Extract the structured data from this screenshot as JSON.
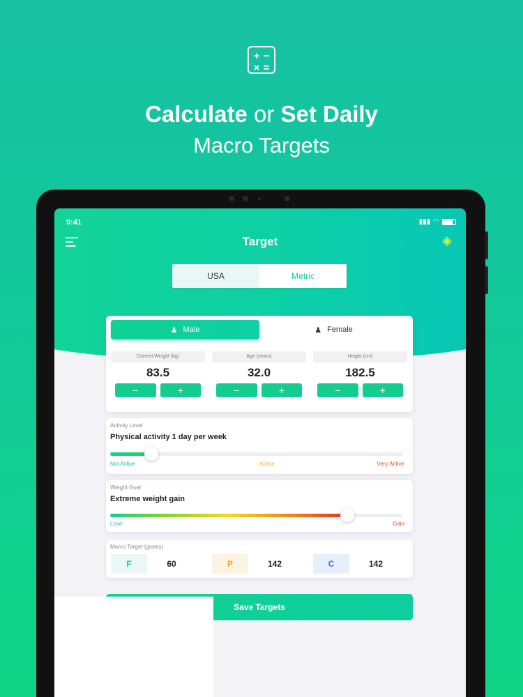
{
  "hero": {
    "title_bold_1": "Calculate",
    "title_middle": " or ",
    "title_bold_2": "Set Daily",
    "subtitle": "Macro Targets",
    "icon": "calculator-icon"
  },
  "status_bar": {
    "time": "9:41"
  },
  "nav": {
    "title": "Target",
    "menu_icon": "menu-icon",
    "premium_icon": "diamond-icon"
  },
  "units": {
    "options": [
      "USA",
      "Metric"
    ],
    "selected": "USA"
  },
  "gender": {
    "options": [
      "Male",
      "Female"
    ],
    "selected": "Male"
  },
  "metrics": [
    {
      "label": "Current Weight (kg)",
      "value": "83.5"
    },
    {
      "label": "Age (years)",
      "value": "32.0"
    },
    {
      "label": "Height (cm)",
      "value": "182.5"
    }
  ],
  "stepper": {
    "minus": "−",
    "plus": "+"
  },
  "activity": {
    "label": "Activity Level",
    "value": "Physical activity 1 day per week",
    "level": 0.14,
    "ticks": [
      "Not Active",
      "Active",
      "Very Active"
    ]
  },
  "weight_goal": {
    "label": "Weight Goal",
    "value": "Extreme weight gain",
    "level": 0.81,
    "ticks": [
      "Lose",
      "Gain"
    ]
  },
  "macros": {
    "label": "Macro Target (grams)",
    "items": [
      {
        "key": "F",
        "value": "60",
        "color": "#16c79f",
        "bg": "#e9f8f4"
      },
      {
        "key": "P",
        "value": "142",
        "color": "#f2a21b",
        "bg": "#fdf3e2"
      },
      {
        "key": "C",
        "value": "142",
        "color": "#2f7fe0",
        "bg": "#e6f0fc"
      }
    ]
  },
  "save_label": "Save Targets"
}
